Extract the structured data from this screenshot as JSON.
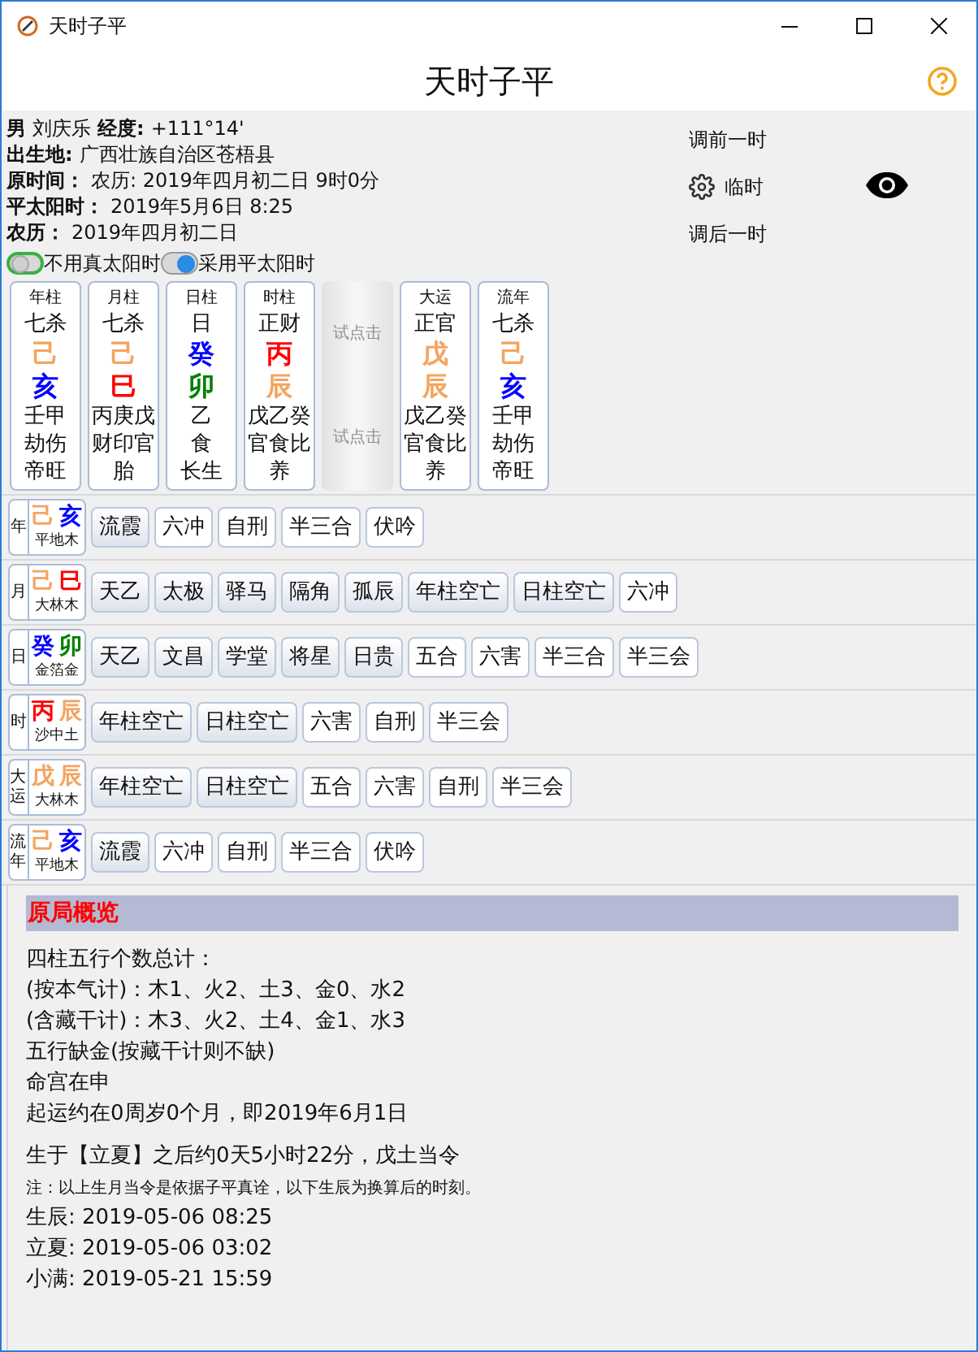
{
  "window": {
    "title": "天时子平",
    "heading": "天时子平"
  },
  "info": [
    {
      "label": "男",
      "value": "刘庆乐",
      "label2": "经度:",
      "value2": "+111°14'"
    },
    {
      "label": "出生地:",
      "value": "广西壮族自治区苍梧县"
    },
    {
      "label": "原时间：",
      "value": "农历: 2019年四月初二日 9时0分"
    },
    {
      "label": "平太阳时：",
      "value": "2019年5月6日 8:25"
    },
    {
      "label": "农历：",
      "value": "2019年四月初二日"
    }
  ],
  "time_controls": {
    "prev": "调前一时",
    "current": "临时",
    "next": "调后一时"
  },
  "toggles": [
    {
      "label": "不用真太阳时",
      "on": false
    },
    {
      "label": "采用平太阳时",
      "on": true
    }
  ],
  "pillars": [
    {
      "kind": "pillar",
      "title": "年柱",
      "god": "七杀",
      "stem": {
        "text": "己",
        "color": "#f4a460"
      },
      "branch": {
        "text": "亥",
        "color": "#0000ff"
      },
      "hidden": "壬甲",
      "hidden_gods": "劫伤",
      "stage": "帝旺"
    },
    {
      "kind": "pillar",
      "title": "月柱",
      "god": "七杀",
      "stem": {
        "text": "己",
        "color": "#f4a460"
      },
      "branch": {
        "text": "巳",
        "color": "#ff0000"
      },
      "hidden": "丙庚戊",
      "hidden_gods": "财印官",
      "stage": "胎"
    },
    {
      "kind": "pillar",
      "title": "日柱",
      "god": "日",
      "stem": {
        "text": "癸",
        "color": "#0000ff"
      },
      "branch": {
        "text": "卯",
        "color": "#008000"
      },
      "hidden": "乙",
      "hidden_gods": "食",
      "stage": "长生"
    },
    {
      "kind": "pillar",
      "title": "时柱",
      "god": "正财",
      "stem": {
        "text": "丙",
        "color": "#ff0000"
      },
      "branch": {
        "text": "辰",
        "color": "#f4a460"
      },
      "hidden": "戊乙癸",
      "hidden_gods": "官食比",
      "stage": "养"
    },
    {
      "kind": "try",
      "top": "试点击",
      "bottom": "试点击"
    },
    {
      "kind": "pillar",
      "title": "大运",
      "god": "正官",
      "stem": {
        "text": "戊",
        "color": "#f4a460"
      },
      "branch": {
        "text": "辰",
        "color": "#f4a460"
      },
      "hidden": "戊乙癸",
      "hidden_gods": "官食比",
      "stage": "养"
    },
    {
      "kind": "pillar",
      "title": "流年",
      "god": "七杀",
      "stem": {
        "text": "己",
        "color": "#f4a460"
      },
      "branch": {
        "text": "亥",
        "color": "#0000ff"
      },
      "hidden": "壬甲",
      "hidden_gods": "劫伤",
      "stage": "帝旺"
    }
  ],
  "relations": [
    {
      "label": "年",
      "stem": {
        "text": "己",
        "color": "#f4a460"
      },
      "branch": {
        "text": "亥",
        "color": "#0000ff"
      },
      "nayin": "平地木",
      "tags": [
        {
          "text": "流霞",
          "highlighted": true
        },
        {
          "text": "六冲",
          "highlighted": false
        },
        {
          "text": "自刑",
          "highlighted": false
        },
        {
          "text": "半三合",
          "highlighted": false
        },
        {
          "text": "伏吟",
          "highlighted": false
        }
      ]
    },
    {
      "label": "月",
      "stem": {
        "text": "己",
        "color": "#f4a460"
      },
      "branch": {
        "text": "巳",
        "color": "#ff0000"
      },
      "nayin": "大林木",
      "tags": [
        {
          "text": "天乙",
          "highlighted": true
        },
        {
          "text": "太极",
          "highlighted": true
        },
        {
          "text": "驿马",
          "highlighted": true
        },
        {
          "text": "隔角",
          "highlighted": true
        },
        {
          "text": "孤辰",
          "highlighted": true
        },
        {
          "text": "年柱空亡",
          "highlighted": true
        },
        {
          "text": "日柱空亡",
          "highlighted": true
        },
        {
          "text": "六冲",
          "highlighted": false
        }
      ]
    },
    {
      "label": "日",
      "stem": {
        "text": "癸",
        "color": "#0000ff"
      },
      "branch": {
        "text": "卯",
        "color": "#008000"
      },
      "nayin": "金箔金",
      "tags": [
        {
          "text": "天乙",
          "highlighted": true
        },
        {
          "text": "文昌",
          "highlighted": true
        },
        {
          "text": "学堂",
          "highlighted": true
        },
        {
          "text": "将星",
          "highlighted": true
        },
        {
          "text": "日贵",
          "highlighted": true
        },
        {
          "text": "五合",
          "highlighted": false
        },
        {
          "text": "六害",
          "highlighted": false
        },
        {
          "text": "半三合",
          "highlighted": false
        },
        {
          "text": "半三会",
          "highlighted": false
        }
      ]
    },
    {
      "label": "时",
      "stem": {
        "text": "丙",
        "color": "#ff0000"
      },
      "branch": {
        "text": "辰",
        "color": "#f4a460"
      },
      "nayin": "沙中土",
      "tags": [
        {
          "text": "年柱空亡",
          "highlighted": true
        },
        {
          "text": "日柱空亡",
          "highlighted": true
        },
        {
          "text": "六害",
          "highlighted": false
        },
        {
          "text": "自刑",
          "highlighted": false
        },
        {
          "text": "半三会",
          "highlighted": false
        }
      ]
    },
    {
      "label": "大运",
      "stem": {
        "text": "戊",
        "color": "#f4a460"
      },
      "branch": {
        "text": "辰",
        "color": "#f4a460"
      },
      "nayin": "大林木",
      "tags": [
        {
          "text": "年柱空亡",
          "highlighted": true
        },
        {
          "text": "日柱空亡",
          "highlighted": true
        },
        {
          "text": "五合",
          "highlighted": false
        },
        {
          "text": "六害",
          "highlighted": false
        },
        {
          "text": "自刑",
          "highlighted": false
        },
        {
          "text": "半三会",
          "highlighted": false
        }
      ]
    },
    {
      "label": "流年",
      "stem": {
        "text": "己",
        "color": "#f4a460"
      },
      "branch": {
        "text": "亥",
        "color": "#0000ff"
      },
      "nayin": "平地木",
      "tags": [
        {
          "text": "流霞",
          "highlighted": true
        },
        {
          "text": "六冲",
          "highlighted": false
        },
        {
          "text": "自刑",
          "highlighted": false
        },
        {
          "text": "半三合",
          "highlighted": false
        },
        {
          "text": "伏吟",
          "highlighted": false
        }
      ]
    }
  ],
  "summary": {
    "title": "原局概览",
    "lines": [
      {
        "kind": "line",
        "text": "四柱五行个数总计："
      },
      {
        "kind": "line",
        "text": "(按本气计)：木1、火2、土3、金0、水2"
      },
      {
        "kind": "line",
        "text": "(含藏干计)：木3、火2、土4、金1、水3"
      },
      {
        "kind": "line",
        "text": "五行缺金(按藏干计则不缺)"
      },
      {
        "kind": "line",
        "text": "命宫在申"
      },
      {
        "kind": "line",
        "text": "起运约在0周岁0个月，即2019年6月1日"
      },
      {
        "kind": "gap_line",
        "text": "生于【立夏】之后约0天5小时22分，戊土当令"
      },
      {
        "kind": "note",
        "text": "注：以上生月当令是依据子平真诠，以下生辰为换算后的时刻。"
      },
      {
        "kind": "line",
        "text": "生辰: 2019-05-06 08:25"
      },
      {
        "kind": "line",
        "text": "立夏: 2019-05-06 03:02"
      },
      {
        "kind": "line",
        "text": "小满: 2019-05-21 15:59"
      }
    ]
  }
}
